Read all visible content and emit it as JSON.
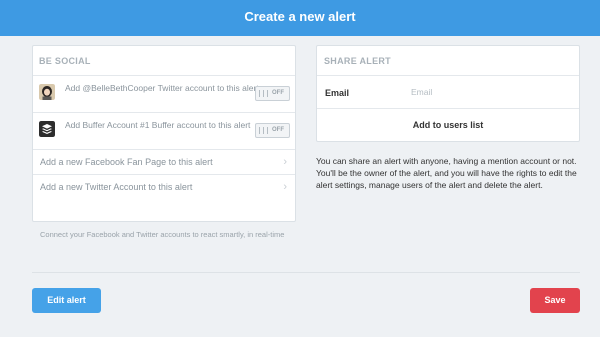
{
  "header": {
    "title": "Create a new alert"
  },
  "social": {
    "title": "BE SOCIAL",
    "accounts": [
      {
        "label": "Add @BelleBethCooper Twitter account to this alert",
        "toggle": "OFF",
        "icon": "user-avatar"
      },
      {
        "label": "Add Buffer Account #1 Buffer account to this alert",
        "toggle": "OFF",
        "icon": "buffer-logo"
      }
    ],
    "add_links": [
      {
        "label": "Add a new Facebook Fan Page to this alert"
      },
      {
        "label": "Add a new Twitter Account to this alert"
      }
    ],
    "hint": "Connect your Facebook and Twitter accounts to react smartly, in real-time"
  },
  "share": {
    "title": "SHARE ALERT",
    "email_label": "Email",
    "email_placeholder": "Email",
    "email_value": "",
    "add_button": "Add to users list",
    "description": "You can share an alert with anyone, having a mention account or not. You'll be the owner of the alert, and you will have the rights to edit the alert settings, manage users of the alert and delete the alert."
  },
  "footer": {
    "edit_label": "Edit alert",
    "save_label": "Save"
  },
  "colors": {
    "header": "#3e9ae3",
    "edit": "#45a2e8",
    "save": "#e2434d",
    "background": "#eef1f4"
  }
}
